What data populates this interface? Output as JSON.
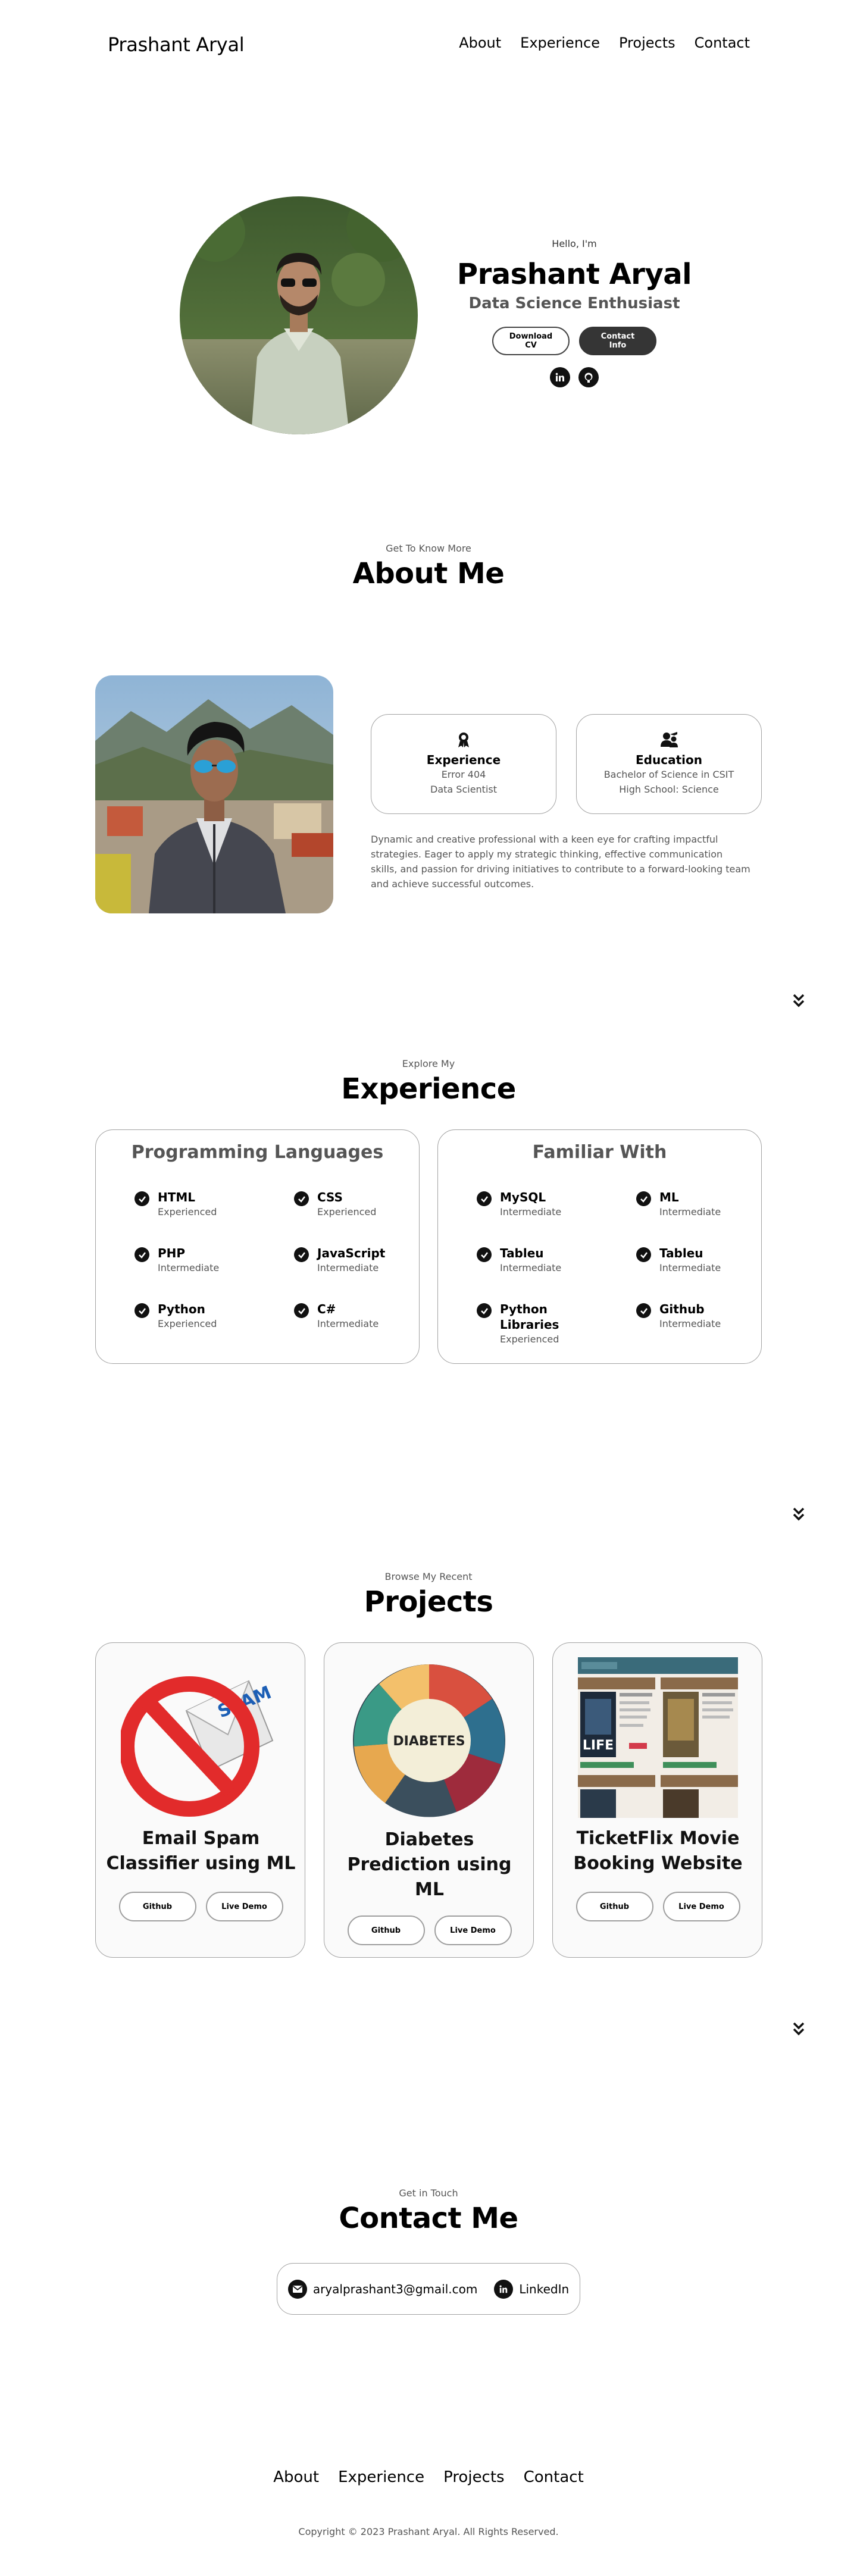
{
  "nav": {
    "logo": "Prashant Aryal",
    "links": [
      "About",
      "Experience",
      "Projects",
      "Contact"
    ]
  },
  "hero": {
    "greeting": "Hello, I'm",
    "name": "Prashant Aryal",
    "title": "Data Science Enthusiast",
    "download_cv": "Download CV",
    "contact_info": "Contact Info",
    "socials": [
      "linkedin-icon",
      "github-icon"
    ]
  },
  "about": {
    "subtitle": "Get To Know More",
    "title": "About Me",
    "cards": [
      {
        "icon": "experience-icon",
        "title": "Experience",
        "lines": [
          "Error 404",
          "Data Scientist"
        ]
      },
      {
        "icon": "education-icon",
        "title": "Education",
        "lines": [
          "Bachelor of Science in CSIT",
          "High School: Science"
        ]
      }
    ],
    "description": "Dynamic and creative professional with a keen eye for crafting impactful strategies. Eager to apply my strategic thinking, effective communication skills, and passion for driving initiatives to contribute to a forward-looking team and achieve successful outcomes."
  },
  "experience": {
    "subtitle": "Explore My",
    "title": "Experience",
    "groups": [
      {
        "title": "Programming Languages",
        "skills": [
          {
            "name": "HTML",
            "level": "Experienced"
          },
          {
            "name": "CSS",
            "level": "Experienced"
          },
          {
            "name": "PHP",
            "level": "Intermediate"
          },
          {
            "name": "JavaScript",
            "level": "Intermediate"
          },
          {
            "name": "Python",
            "level": "Experienced"
          },
          {
            "name": "C#",
            "level": "Intermediate"
          }
        ]
      },
      {
        "title": "Familiar With",
        "skills": [
          {
            "name": "MySQL",
            "level": "Intermediate"
          },
          {
            "name": "ML",
            "level": "Intermediate"
          },
          {
            "name": "Tableu",
            "level": "Intermediate"
          },
          {
            "name": "Tableu",
            "level": "Intermediate"
          },
          {
            "name": "Python Libraries",
            "level": "Experienced"
          },
          {
            "name": "Github",
            "level": "Intermediate"
          }
        ]
      }
    ]
  },
  "projects": {
    "subtitle": "Browse My Recent",
    "title": "Projects",
    "items": [
      {
        "title": "Email Spam Classifier using ML",
        "github": "Github",
        "demo": "Live Demo",
        "image_text": "SPAM"
      },
      {
        "title": "Diabetes Prediction using ML",
        "github": "Github",
        "demo": "Live Demo",
        "image_text": "DIABETES"
      },
      {
        "title": "TicketFlix Movie Booking Website",
        "github": "Github",
        "demo": "Live Demo",
        "image_text": "LIFE"
      }
    ]
  },
  "contact": {
    "subtitle": "Get in Touch",
    "title": "Contact Me",
    "email": "aryalprashant3@gmail.com",
    "linkedin": "LinkedIn"
  },
  "footer": {
    "links": [
      "About",
      "Experience",
      "Projects",
      "Contact"
    ],
    "copyright": "Copyright © 2023 Prashant Aryal. All Rights Reserved."
  }
}
